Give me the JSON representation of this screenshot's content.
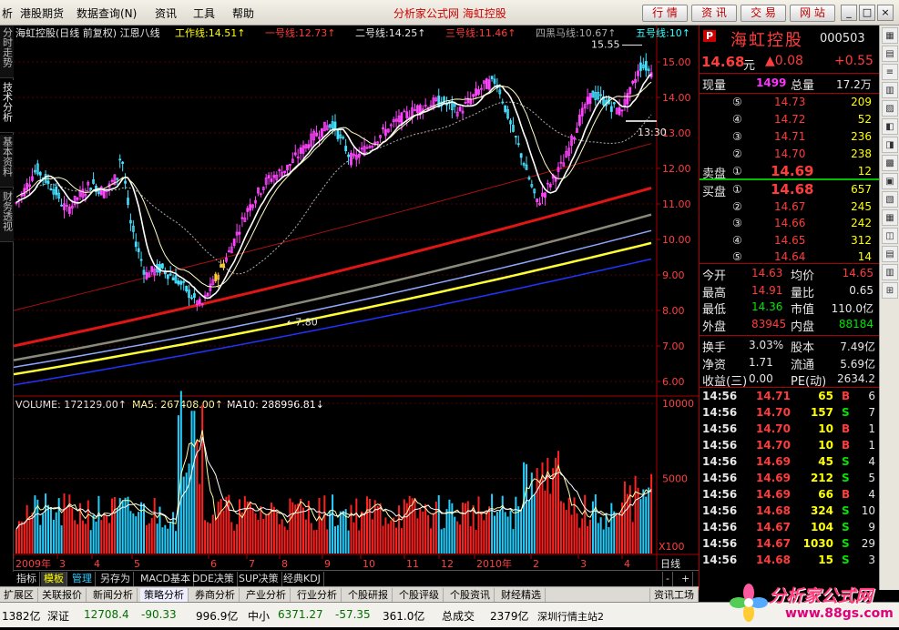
{
  "menubar": {
    "items": [
      "析",
      "港股期货",
      "数据查询(N)",
      "资讯",
      "工具",
      "帮助"
    ],
    "center_title": "分析家公式网 海虹控股",
    "buttons": [
      "行 情",
      "资 讯",
      "交 易",
      "网 站"
    ]
  },
  "left_tabs": [
    "分时走势",
    "技术分析",
    "基本资料",
    "财务透视"
  ],
  "chart": {
    "header": "海虹控股(日线 前复权) 江恩八线",
    "indicators": [
      {
        "label": "工作线:",
        "value": "14.51",
        "color": "#ffff00"
      },
      {
        "label": "一号线:",
        "value": "12.73",
        "color": "#ff3c3c"
      },
      {
        "label": "二号线:",
        "value": "14.25",
        "color": "#e6e6e6"
      },
      {
        "label": "三号线:",
        "value": "11.46",
        "color": "#ff3c3c"
      },
      {
        "label": "四黑马线:",
        "value": "10.67",
        "color": "#aaaaaa"
      },
      {
        "label": "五号线:",
        "value": "10",
        "color": "#33ffff"
      }
    ],
    "price_ticks": [
      "15.00",
      "14.00",
      "13.00",
      "12.00",
      "11.00",
      "10.00",
      "9.00",
      "8.00",
      "7.00",
      "6.00"
    ],
    "high_label": "15.55",
    "low_label": "7.80",
    "time_marker": "13:30",
    "vol_header": {
      "volume": "VOLUME: 172129.00",
      "ma5": "MA5: 267408.00",
      "ma10": "MA10: 288996.81"
    },
    "vol_ticks": [
      "10000",
      "5000"
    ],
    "vol_unit": "X100",
    "months": [
      "2009年",
      "3",
      "4",
      "5",
      "6",
      "7",
      "8",
      "9",
      "10",
      "11",
      "12",
      "2010年",
      "2",
      "3",
      "4"
    ],
    "period": "日线"
  },
  "quote": {
    "badge": "P",
    "name": "海虹控股",
    "code": "000503",
    "price": "14.68",
    "price_unit": "元",
    "change": "▲0.08",
    "change_pct": "+0.55",
    "xianliang_label": "现量",
    "xianliang": "1499",
    "zongliang_label": "总量",
    "zongliang": "17.2万",
    "sell_label": "卖盘",
    "buy_label": "买盘",
    "asks": [
      {
        "n": "⑤",
        "p": "14.73",
        "v": "209"
      },
      {
        "n": "④",
        "p": "14.72",
        "v": "52"
      },
      {
        "n": "③",
        "p": "14.71",
        "v": "236"
      },
      {
        "n": "②",
        "p": "14.70",
        "v": "238"
      },
      {
        "n": "①",
        "p": "14.69",
        "v": "12"
      }
    ],
    "bids": [
      {
        "n": "①",
        "p": "14.68",
        "v": "657"
      },
      {
        "n": "②",
        "p": "14.67",
        "v": "245"
      },
      {
        "n": "③",
        "p": "14.66",
        "v": "242"
      },
      {
        "n": "④",
        "p": "14.65",
        "v": "312"
      },
      {
        "n": "⑤",
        "p": "14.64",
        "v": "14"
      }
    ],
    "stats": [
      {
        "l1": "今开",
        "v1": "14.63",
        "c1": "red",
        "l2": "均价",
        "v2": "14.65",
        "c2": "red"
      },
      {
        "l1": "最高",
        "v1": "14.91",
        "c1": "red",
        "l2": "量比",
        "v2": "0.65",
        "c2": "white"
      },
      {
        "l1": "最低",
        "v1": "14.36",
        "c1": "green",
        "l2": "市值",
        "v2": "110.0亿",
        "c2": "white"
      },
      {
        "l1": "外盘",
        "v1": "83945",
        "c1": "red",
        "l2": "内盘",
        "v2": "88184",
        "c2": "green"
      }
    ],
    "stats2": [
      {
        "l1": "换手",
        "v1": "3.03%",
        "l2": "股本",
        "v2": "7.49亿"
      },
      {
        "l1": "净资",
        "v1": "1.71",
        "l2": "流通",
        "v2": "5.69亿"
      },
      {
        "l1": "收益(三)",
        "v1": "0.00",
        "l2": "PE(动)",
        "v2": "2634.2"
      }
    ],
    "ticks": [
      {
        "t": "14:56",
        "p": "14.71",
        "v": "65",
        "s": "B",
        "n": "6"
      },
      {
        "t": "14:56",
        "p": "14.70",
        "v": "157",
        "s": "S",
        "n": "7"
      },
      {
        "t": "14:56",
        "p": "14.70",
        "v": "10",
        "s": "B",
        "n": "1"
      },
      {
        "t": "14:56",
        "p": "14.70",
        "v": "10",
        "s": "B",
        "n": "1"
      },
      {
        "t": "14:56",
        "p": "14.69",
        "v": "45",
        "s": "S",
        "n": "4"
      },
      {
        "t": "14:56",
        "p": "14.69",
        "v": "212",
        "s": "S",
        "n": "5"
      },
      {
        "t": "14:56",
        "p": "14.69",
        "v": "66",
        "s": "B",
        "n": "4"
      },
      {
        "t": "14:56",
        "p": "14.68",
        "v": "324",
        "s": "S",
        "n": "10"
      },
      {
        "t": "14:56",
        "p": "14.67",
        "v": "104",
        "s": "S",
        "n": "9"
      },
      {
        "t": "14:56",
        "p": "14.67",
        "v": "1030",
        "s": "S",
        "n": "29"
      },
      {
        "t": "14:56",
        "p": "14.68",
        "v": "15",
        "s": "S",
        "n": "3"
      }
    ]
  },
  "bottom_tabs": [
    "指标",
    "模板",
    "管理",
    "另存为",
    "MACD基本",
    "DDE决策",
    "SUP决策",
    "经典KDJ"
  ],
  "func_bar": [
    "扩展区",
    "关联报价",
    "新闻分析",
    "策略分析",
    "券商分析",
    "产业分析",
    "行业分析",
    "个股研报",
    "个股评级",
    "个股资讯",
    "财经精选"
  ],
  "func_right": "资讯工场",
  "status": {
    "seg1": "1382亿",
    "sz_label": "深证",
    "sz_index": "12708.4",
    "sz_change": "-90.33",
    "sz_amount": "996.9亿",
    "zx_label": "中小",
    "zx_index": "6371.27",
    "zx_change": "-57.35",
    "zx_amount": "361.0亿",
    "total_label": "总成交",
    "total_amount": "2379亿",
    "station": "深圳行情主站2"
  },
  "watermark": {
    "title": "分析家公式网",
    "url": "www.88gs.com"
  },
  "colors": {
    "up": "#ff3c3c",
    "down": "#00e600",
    "bg": "#000000",
    "bull": "#ff44ff",
    "bear": "#44e0ff"
  }
}
